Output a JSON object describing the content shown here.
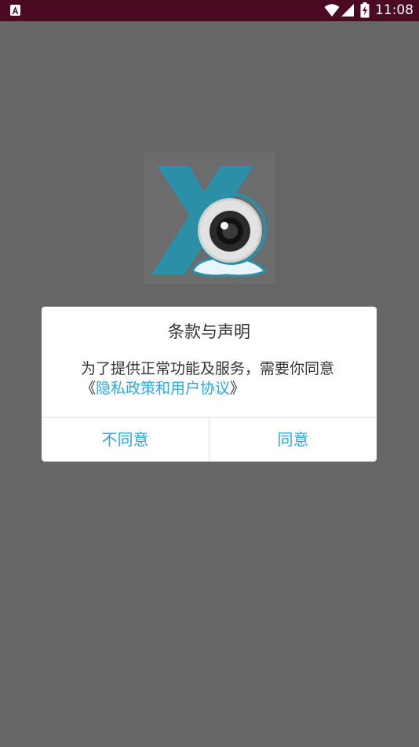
{
  "status_bar": {
    "time": "11:08",
    "icons": [
      "app-notification-icon",
      "wifi-icon",
      "cell-signal-icon",
      "battery-charging-icon"
    ]
  },
  "logo": {
    "icon": "webcam-x-logo",
    "colors": {
      "x": "#2b8fa8",
      "camera_body": "#d9d9d9",
      "lens": "#222222"
    }
  },
  "dialog": {
    "title": "条款与声明",
    "body_prefix": "为了提供正常功能及服务，需要你同意《",
    "body_link": "隐私政策和用户协议",
    "body_suffix": "》",
    "disagree_label": "不同意",
    "agree_label": "同意"
  },
  "colors": {
    "status_bar": "#4a0a21",
    "scrim": "#666666",
    "accent": "#2fa8dc"
  }
}
